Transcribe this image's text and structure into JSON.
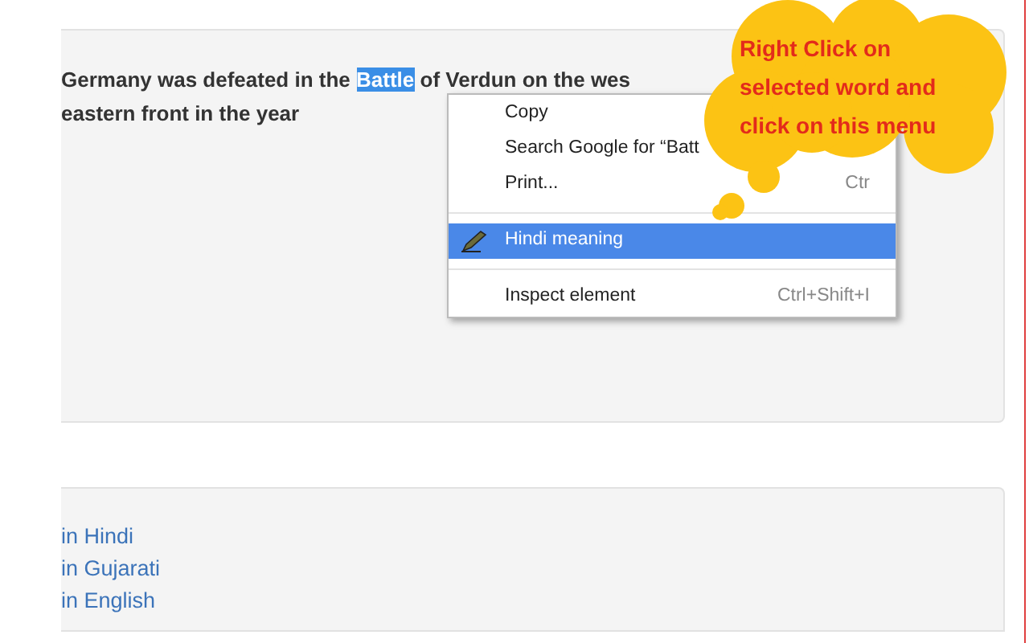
{
  "article": {
    "text_before": "Germany was defeated in the",
    "selected_word": {
      "text": "Battle",
      "selected": true
    },
    "text_after": "of Verdun on the wes",
    "line_2": "eastern front in the year"
  },
  "context_menu": {
    "items": [
      {
        "kind": "item",
        "label": "Copy",
        "selected": false
      },
      {
        "kind": "item",
        "label": "Search Google for “Batt",
        "selected": false
      },
      {
        "kind": "item",
        "label": "Print...",
        "shortcut": "Ctr",
        "selected": false
      },
      {
        "kind": "separator"
      },
      {
        "kind": "item",
        "label": "Hindi meaning",
        "icon": true,
        "selected": true
      },
      {
        "kind": "separator"
      },
      {
        "kind": "item",
        "label": "Inspect element",
        "shortcut": "Ctrl+Shift+I",
        "selected": false
      }
    ]
  },
  "callout": {
    "text": "Right Click on selected word and click on this menu"
  },
  "links": [
    "in Hindi",
    "in Gujarati",
    "in English"
  ]
}
